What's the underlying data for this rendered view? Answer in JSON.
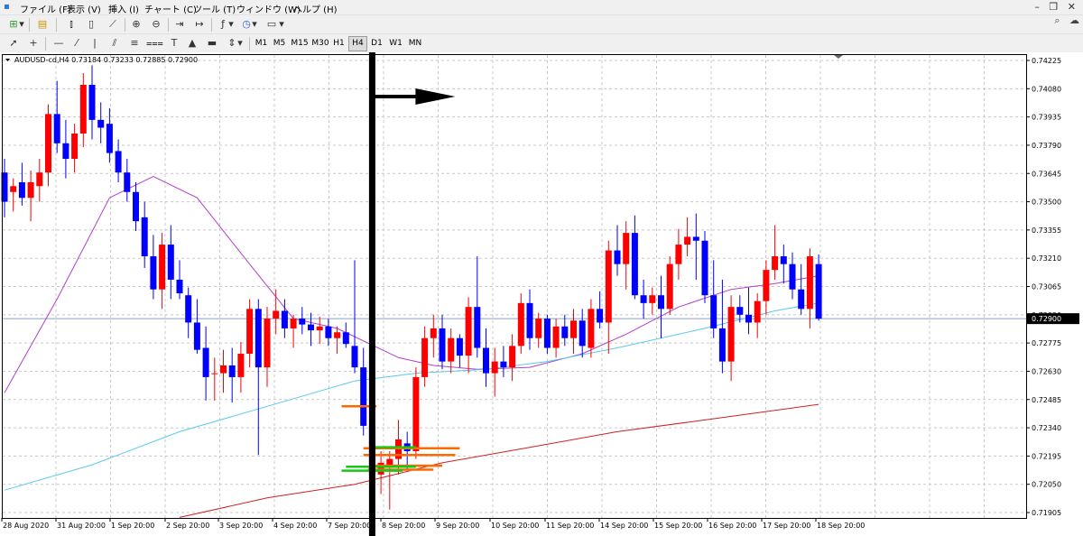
{
  "menu": [
    "ファイル (F)",
    "表示 (V)",
    "挿入 (I)",
    "チャート (C)",
    "ツール (T)",
    "ウィンドウ (W)",
    "ヘルプ (H)"
  ],
  "toolbar": {
    "timeframes": [
      "M1",
      "M5",
      "M15",
      "M30",
      "H1",
      "H4",
      "D1",
      "W1",
      "MN"
    ],
    "active_timeframe": "H4"
  },
  "chart_data": {
    "type": "candlestick",
    "title": "AUDUSD-cd,H4  0.73184 0.73233 0.72885 0.72900",
    "symbol": "AUDUSD-cd",
    "timeframe": "H4",
    "ohlc": {
      "open": 0.73184,
      "high": 0.73233,
      "low": 0.72885,
      "close": 0.729
    },
    "bid_price_label": "0.72900",
    "ylim": [
      0.71905,
      0.74225
    ],
    "yticks": [
      0.74225,
      0.7408,
      0.73935,
      0.7379,
      0.73645,
      0.735,
      0.73355,
      0.7321,
      0.73065,
      0.7292,
      0.72775,
      0.7263,
      0.72485,
      0.7234,
      0.72195,
      0.7205,
      0.71905
    ],
    "xlabels": [
      "28 Aug 2020",
      "31 Aug 20:00",
      "1 Sep 20:00",
      "2 Sep 20:00",
      "3 Sep 20:00",
      "4 Sep 20:00",
      "7 Sep 20:00",
      "8 Sep 20:00",
      "9 Sep 20:00",
      "10 Sep 20:00",
      "11 Sep 20:00",
      "14 Sep 20:00",
      "15 Sep 20:00",
      "16 Sep 20:00",
      "17 Sep 20:00",
      "18 Sep 20:00"
    ],
    "candles": [
      [
        0.7365,
        0.7372,
        0.7342,
        0.735
      ],
      [
        0.7355,
        0.7362,
        0.7345,
        0.7358
      ],
      [
        0.736,
        0.737,
        0.7348,
        0.7352
      ],
      [
        0.7352,
        0.7366,
        0.734,
        0.736
      ],
      [
        0.7358,
        0.7372,
        0.735,
        0.7365
      ],
      [
        0.7365,
        0.74,
        0.7358,
        0.7395
      ],
      [
        0.7395,
        0.7412,
        0.7375,
        0.738
      ],
      [
        0.738,
        0.7392,
        0.7362,
        0.7372
      ],
      [
        0.7372,
        0.739,
        0.7365,
        0.7385
      ],
      [
        0.7385,
        0.7416,
        0.7378,
        0.741
      ],
      [
        0.741,
        0.742,
        0.7382,
        0.7392
      ],
      [
        0.7392,
        0.7401,
        0.738,
        0.7388
      ],
      [
        0.739,
        0.7398,
        0.737,
        0.7375
      ],
      [
        0.7376,
        0.7382,
        0.736,
        0.7365
      ],
      [
        0.7365,
        0.7372,
        0.735,
        0.7355
      ],
      [
        0.7355,
        0.736,
        0.7335,
        0.734
      ],
      [
        0.7342,
        0.735,
        0.7316,
        0.7322
      ],
      [
        0.7322,
        0.7333,
        0.73,
        0.7305
      ],
      [
        0.7305,
        0.7334,
        0.7295,
        0.7328
      ],
      [
        0.7328,
        0.7338,
        0.73,
        0.731
      ],
      [
        0.731,
        0.732,
        0.73,
        0.7303
      ],
      [
        0.7302,
        0.7306,
        0.728,
        0.7288
      ],
      [
        0.7288,
        0.73,
        0.7272,
        0.7274
      ],
      [
        0.7275,
        0.7286,
        0.7248,
        0.726
      ],
      [
        0.7262,
        0.727,
        0.7248,
        0.7262
      ],
      [
        0.7262,
        0.7274,
        0.7252,
        0.7266
      ],
      [
        0.7266,
        0.7275,
        0.7247,
        0.726
      ],
      [
        0.726,
        0.7278,
        0.7252,
        0.7272
      ],
      [
        0.7272,
        0.73,
        0.7265,
        0.7295
      ],
      [
        0.7295,
        0.73,
        0.722,
        0.7265
      ],
      [
        0.7265,
        0.7296,
        0.7255,
        0.729
      ],
      [
        0.729,
        0.7305,
        0.7282,
        0.7294
      ],
      [
        0.7294,
        0.73,
        0.728,
        0.7285
      ],
      [
        0.7285,
        0.7292,
        0.7275,
        0.729
      ],
      [
        0.729,
        0.7296,
        0.7282,
        0.7287
      ],
      [
        0.7287,
        0.7293,
        0.7276,
        0.7284
      ],
      [
        0.7284,
        0.7291,
        0.7277,
        0.7286
      ],
      [
        0.7286,
        0.729,
        0.7276,
        0.728
      ],
      [
        0.728,
        0.7286,
        0.7272,
        0.7283
      ],
      [
        0.7283,
        0.7288,
        0.7275,
        0.7277
      ],
      [
        0.7276,
        0.732,
        0.7262,
        0.7265
      ],
      [
        0.7265,
        0.7275,
        0.723,
        0.7235
      ],
      [
        0.7235,
        0.724,
        0.7206,
        0.721
      ],
      [
        0.721,
        0.7222,
        0.72,
        0.7216
      ],
      [
        0.7215,
        0.7222,
        0.7192,
        0.7218
      ],
      [
        0.7218,
        0.7238,
        0.721,
        0.7228
      ],
      [
        0.7226,
        0.7232,
        0.7212,
        0.7222
      ],
      [
        0.7222,
        0.7265,
        0.7218,
        0.726
      ],
      [
        0.726,
        0.7286,
        0.7255,
        0.728
      ],
      [
        0.728,
        0.7292,
        0.727,
        0.7285
      ],
      [
        0.7285,
        0.7292,
        0.7264,
        0.7268
      ],
      [
        0.7268,
        0.7285,
        0.7262,
        0.728
      ],
      [
        0.728,
        0.7282,
        0.7265,
        0.7271
      ],
      [
        0.7271,
        0.7301,
        0.7262,
        0.7296
      ],
      [
        0.7296,
        0.7322,
        0.727,
        0.7275
      ],
      [
        0.7275,
        0.7285,
        0.7255,
        0.7262
      ],
      [
        0.7262,
        0.7275,
        0.725,
        0.7268
      ],
      [
        0.7268,
        0.7276,
        0.726,
        0.7265
      ],
      [
        0.7265,
        0.7282,
        0.7258,
        0.7276
      ],
      [
        0.7276,
        0.7303,
        0.7272,
        0.7298
      ],
      [
        0.7298,
        0.7305,
        0.7274,
        0.728
      ],
      [
        0.728,
        0.7293,
        0.7275,
        0.729
      ],
      [
        0.729,
        0.7292,
        0.7272,
        0.7275
      ],
      [
        0.7275,
        0.729,
        0.727,
        0.7286
      ],
      [
        0.7286,
        0.7292,
        0.7276,
        0.728
      ],
      [
        0.728,
        0.7295,
        0.7272,
        0.7289
      ],
      [
        0.7289,
        0.7295,
        0.727,
        0.7276
      ],
      [
        0.7275,
        0.73,
        0.727,
        0.7295
      ],
      [
        0.7295,
        0.7304,
        0.7285,
        0.7288
      ],
      [
        0.7288,
        0.733,
        0.7272,
        0.7325
      ],
      [
        0.7325,
        0.7338,
        0.7312,
        0.7318
      ],
      [
        0.7318,
        0.734,
        0.7305,
        0.7334
      ],
      [
        0.7334,
        0.7343,
        0.73,
        0.7302
      ],
      [
        0.7302,
        0.731,
        0.729,
        0.7298
      ],
      [
        0.7298,
        0.7306,
        0.7292,
        0.7302
      ],
      [
        0.7302,
        0.7312,
        0.728,
        0.7295
      ],
      [
        0.7295,
        0.7322,
        0.7292,
        0.7318
      ],
      [
        0.7318,
        0.7336,
        0.731,
        0.7328
      ],
      [
        0.7328,
        0.7342,
        0.7322,
        0.7332
      ],
      [
        0.7332,
        0.7344,
        0.731,
        0.733
      ],
      [
        0.733,
        0.7335,
        0.7298,
        0.7302
      ],
      [
        0.7302,
        0.732,
        0.728,
        0.7285
      ],
      [
        0.7285,
        0.731,
        0.7262,
        0.7268
      ],
      [
        0.7268,
        0.7302,
        0.7258,
        0.7296
      ],
      [
        0.7296,
        0.7302,
        0.7288,
        0.7292
      ],
      [
        0.7292,
        0.7306,
        0.7282,
        0.7288
      ],
      [
        0.7288,
        0.7303,
        0.728,
        0.7299
      ],
      [
        0.7299,
        0.732,
        0.7292,
        0.7315
      ],
      [
        0.7315,
        0.7338,
        0.731,
        0.7322
      ],
      [
        0.7322,
        0.7328,
        0.7308,
        0.7318
      ],
      [
        0.7318,
        0.7324,
        0.73,
        0.7305
      ],
      [
        0.7305,
        0.7318,
        0.7292,
        0.7295
      ],
      [
        0.7295,
        0.7326,
        0.7285,
        0.7322
      ],
      [
        0.7318,
        0.7323,
        0.7289,
        0.729
      ]
    ],
    "indicators": [
      {
        "name": "",
        "color": "#b040c8",
        "points": [
          [
            0,
            0.7252
          ],
          [
            6,
            0.73
          ],
          [
            12,
            0.7352
          ],
          [
            17,
            0.7363
          ],
          [
            22,
            0.7352
          ],
          [
            28,
            0.7318
          ],
          [
            33,
            0.729
          ],
          [
            38,
            0.7285
          ],
          [
            45,
            0.727
          ],
          [
            49,
            0.7266
          ],
          [
            54,
            0.7264
          ],
          [
            60,
            0.7265
          ],
          [
            66,
            0.7272
          ],
          [
            71,
            0.7282
          ],
          [
            77,
            0.7296
          ],
          [
            83,
            0.7305
          ],
          [
            88,
            0.7308
          ],
          [
            93,
            0.7312
          ]
        ]
      },
      {
        "name": "",
        "color": "#5ac8f0",
        "points": [
          [
            0,
            0.7202
          ],
          [
            10,
            0.7215
          ],
          [
            20,
            0.7232
          ],
          [
            30,
            0.7245
          ],
          [
            40,
            0.7258
          ],
          [
            47,
            0.7262
          ],
          [
            55,
            0.7264
          ],
          [
            62,
            0.7268
          ],
          [
            70,
            0.7275
          ],
          [
            80,
            0.7285
          ],
          [
            88,
            0.7294
          ],
          [
            93,
            0.7298
          ]
        ]
      },
      {
        "name": "",
        "color": "#d02020",
        "points": [
          [
            20,
            0.7188
          ],
          [
            30,
            0.7198
          ],
          [
            40,
            0.7205
          ],
          [
            50,
            0.7216
          ],
          [
            60,
            0.7224
          ],
          [
            70,
            0.7232
          ],
          [
            80,
            0.7238
          ],
          [
            93,
            0.7246
          ]
        ]
      }
    ],
    "level_lines": [
      {
        "color": "#ff6a00",
        "y": 0.7245,
        "x": [
          38.5,
          42.5
        ]
      },
      {
        "color": "#ff6a00",
        "y": 0.72235,
        "x": [
          41.0,
          52.0
        ]
      },
      {
        "color": "#ff6a00",
        "y": 0.722,
        "x": [
          41.0,
          51.5
        ]
      },
      {
        "color": "#ff6a00",
        "y": 0.72145,
        "x": [
          42.0,
          50.0
        ]
      },
      {
        "color": "#ff6a00",
        "y": 0.72125,
        "x": [
          41.5,
          49.0
        ]
      },
      {
        "color": "#16c816",
        "y": 0.7224,
        "x": [
          42.0,
          47.0
        ]
      },
      {
        "color": "#16c816",
        "y": 0.7214,
        "x": [
          39.0,
          47.0
        ]
      },
      {
        "color": "#16c816",
        "y": 0.7212,
        "x": [
          38.5,
          45.5
        ]
      }
    ],
    "marker": {
      "x": 42,
      "color": "#000000",
      "arrow": "right"
    },
    "grid": true,
    "legend": "none"
  }
}
